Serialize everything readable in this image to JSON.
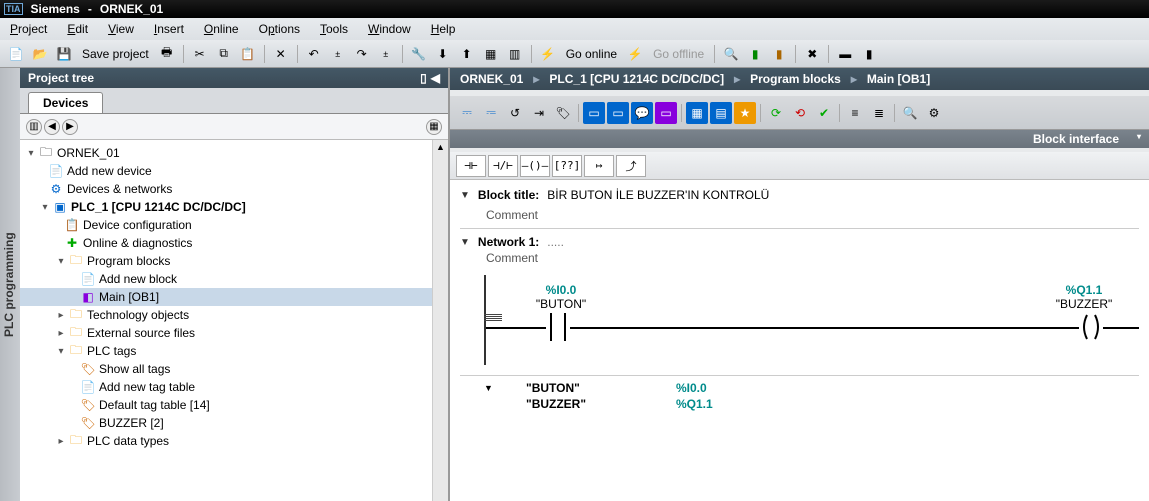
{
  "title": {
    "vendor": "Siemens",
    "project": "ORNEK_01"
  },
  "menu": {
    "items": [
      "Project",
      "Edit",
      "View",
      "Insert",
      "Online",
      "Options",
      "Tools",
      "Window",
      "Help"
    ]
  },
  "toolbar": {
    "save": "Save project",
    "goonline": "Go online",
    "gooffline": "Go offline"
  },
  "left": {
    "panel": "Project tree",
    "tab": "Devices",
    "tree": {
      "root": "ORNEK_01",
      "add_device": "Add new device",
      "dev_net": "Devices & networks",
      "plc": "PLC_1 [CPU 1214C DC/DC/DC]",
      "dev_cfg": "Device configuration",
      "online_diag": "Online & diagnostics",
      "prog_blocks": "Program blocks",
      "add_block": "Add new block",
      "main": "Main [OB1]",
      "tech_obj": "Technology objects",
      "ext_src": "External source files",
      "plc_tags": "PLC tags",
      "show_tags": "Show all tags",
      "add_tag": "Add new tag table",
      "def_tag": "Default tag table [14]",
      "buzzer_tag": "BUZZER [2]",
      "plc_dtypes": "PLC data types"
    }
  },
  "right": {
    "crumbs": [
      "ORNEK_01",
      "PLC_1 [CPU 1214C DC/DC/DC]",
      "Program blocks",
      "Main [OB1]"
    ],
    "block_iface": "Block interface",
    "block_title_label": "Block title:",
    "block_title": "BİR BUTON İLE BUZZER'IN KONTROLÜ",
    "comment": "Comment",
    "network_label": "Network 1:",
    "network_suffix": ".....",
    "ladder": {
      "in_addr": "%I0.0",
      "in_name": "\"BUTON\"",
      "out_addr": "%Q1.1",
      "out_name": "\"BUZZER\""
    },
    "xref": [
      {
        "name": "\"BUTON\"",
        "addr": "%I0.0"
      },
      {
        "name": "\"BUZZER\"",
        "addr": "%Q1.1"
      }
    ]
  },
  "vtab": "PLC programming"
}
